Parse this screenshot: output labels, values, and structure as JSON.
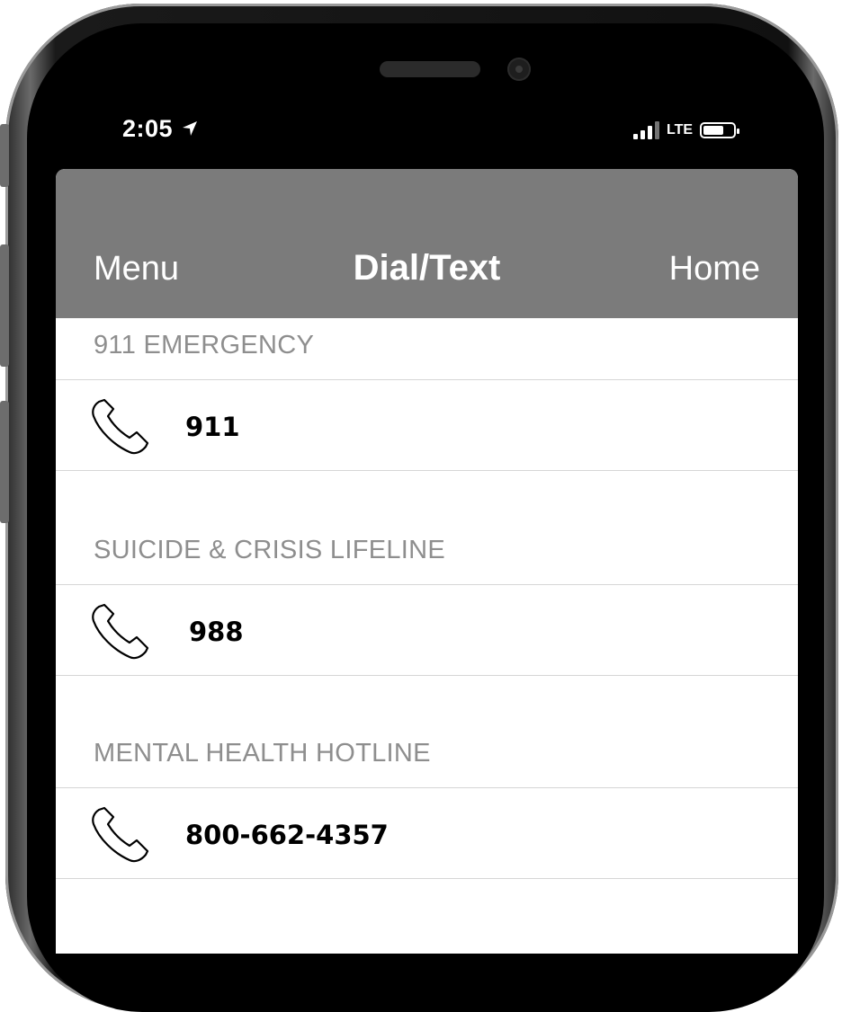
{
  "status_bar": {
    "time": "2:05",
    "network": "LTE"
  },
  "navbar": {
    "left_button": "Menu",
    "title": "Dial/Text",
    "right_button": "Home"
  },
  "sections": [
    {
      "header": "911 EMERGENCY",
      "number": "911"
    },
    {
      "header": "SUICIDE & CRISIS LIFELINE",
      "number": "988"
    },
    {
      "header": "MENTAL HEALTH HOTLINE",
      "number": "800-662-4357"
    }
  ]
}
